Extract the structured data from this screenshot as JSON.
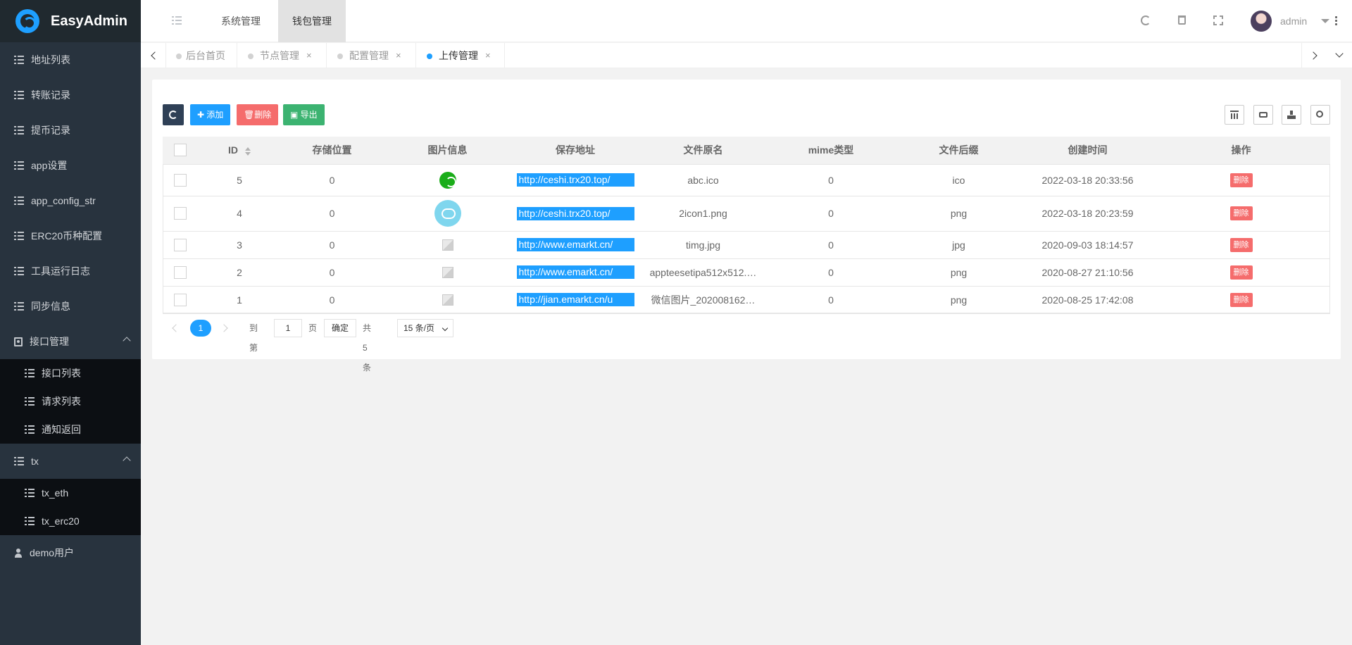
{
  "app": {
    "title": "EasyAdmin"
  },
  "sidebar": {
    "items": [
      {
        "label": "地址列表"
      },
      {
        "label": "转账记录"
      },
      {
        "label": "提币记录"
      },
      {
        "label": "app设置"
      },
      {
        "label": "app_config_str"
      },
      {
        "label": "ERC20币种配置"
      },
      {
        "label": "工具运行日志"
      },
      {
        "label": "同步信息"
      }
    ],
    "groups": [
      {
        "label": "接口管理",
        "children": [
          {
            "label": "接口列表"
          },
          {
            "label": "请求列表"
          },
          {
            "label": "通知返回"
          }
        ]
      },
      {
        "label": "tx",
        "children": [
          {
            "label": "tx_eth"
          },
          {
            "label": "tx_erc20"
          }
        ]
      }
    ],
    "footer_item": {
      "label": "demo用户"
    }
  },
  "header": {
    "top_tabs": [
      {
        "label": "系统管理"
      },
      {
        "label": "钱包管理"
      }
    ],
    "user": {
      "name": "admin"
    }
  },
  "page_tabs": [
    {
      "label": "后台首页"
    },
    {
      "label": "节点管理",
      "close": "×"
    },
    {
      "label": "配置管理",
      "close": "×"
    },
    {
      "label": "上传管理",
      "close": "×"
    }
  ],
  "toolbar": {
    "add_label": "添加",
    "delete_label": "删除",
    "export_label": "导出"
  },
  "table": {
    "columns": [
      "ID",
      "存储位置",
      "图片信息",
      "保存地址",
      "文件原名",
      "mime类型",
      "文件后缀",
      "创建时间",
      "操作"
    ],
    "action_label": "删除",
    "rows": [
      {
        "id": "5",
        "storage": "0",
        "image": "frog",
        "url": "http://ceshi.trx20.top/",
        "name": "abc.ico",
        "mime": "0",
        "ext": "ico",
        "time": "2022-03-18 20:33:56"
      },
      {
        "id": "4",
        "storage": "0",
        "image": "cloud",
        "url": "http://ceshi.trx20.top/",
        "name": "2icon1.png",
        "mime": "0",
        "ext": "png",
        "time": "2022-03-18 20:23:59"
      },
      {
        "id": "3",
        "storage": "0",
        "image": "broken",
        "url": "http://www.emarkt.cn/",
        "name": "timg.jpg",
        "mime": "0",
        "ext": "jpg",
        "time": "2020-09-03 18:14:57"
      },
      {
        "id": "2",
        "storage": "0",
        "image": "broken",
        "url": "http://www.emarkt.cn/",
        "name": "appteesetipa512x512.…",
        "mime": "0",
        "ext": "png",
        "time": "2020-08-27 21:10:56"
      },
      {
        "id": "1",
        "storage": "0",
        "image": "broken",
        "url": "http://jian.emarkt.cn/u",
        "name": "微信图片_202008162…",
        "mime": "0",
        "ext": "png",
        "time": "2020-08-25 17:42:08"
      }
    ]
  },
  "pagination": {
    "current": "1",
    "goto_label": "到第",
    "page_value": "1",
    "page_unit": "页",
    "confirm_label": "确定",
    "total_label": "共 5 条",
    "per_page": "15 条/页"
  },
  "colors": {
    "sidebar_bg": "#28333e",
    "accent": "#1e9fff",
    "danger": "#ff5722",
    "success": "#009688"
  }
}
